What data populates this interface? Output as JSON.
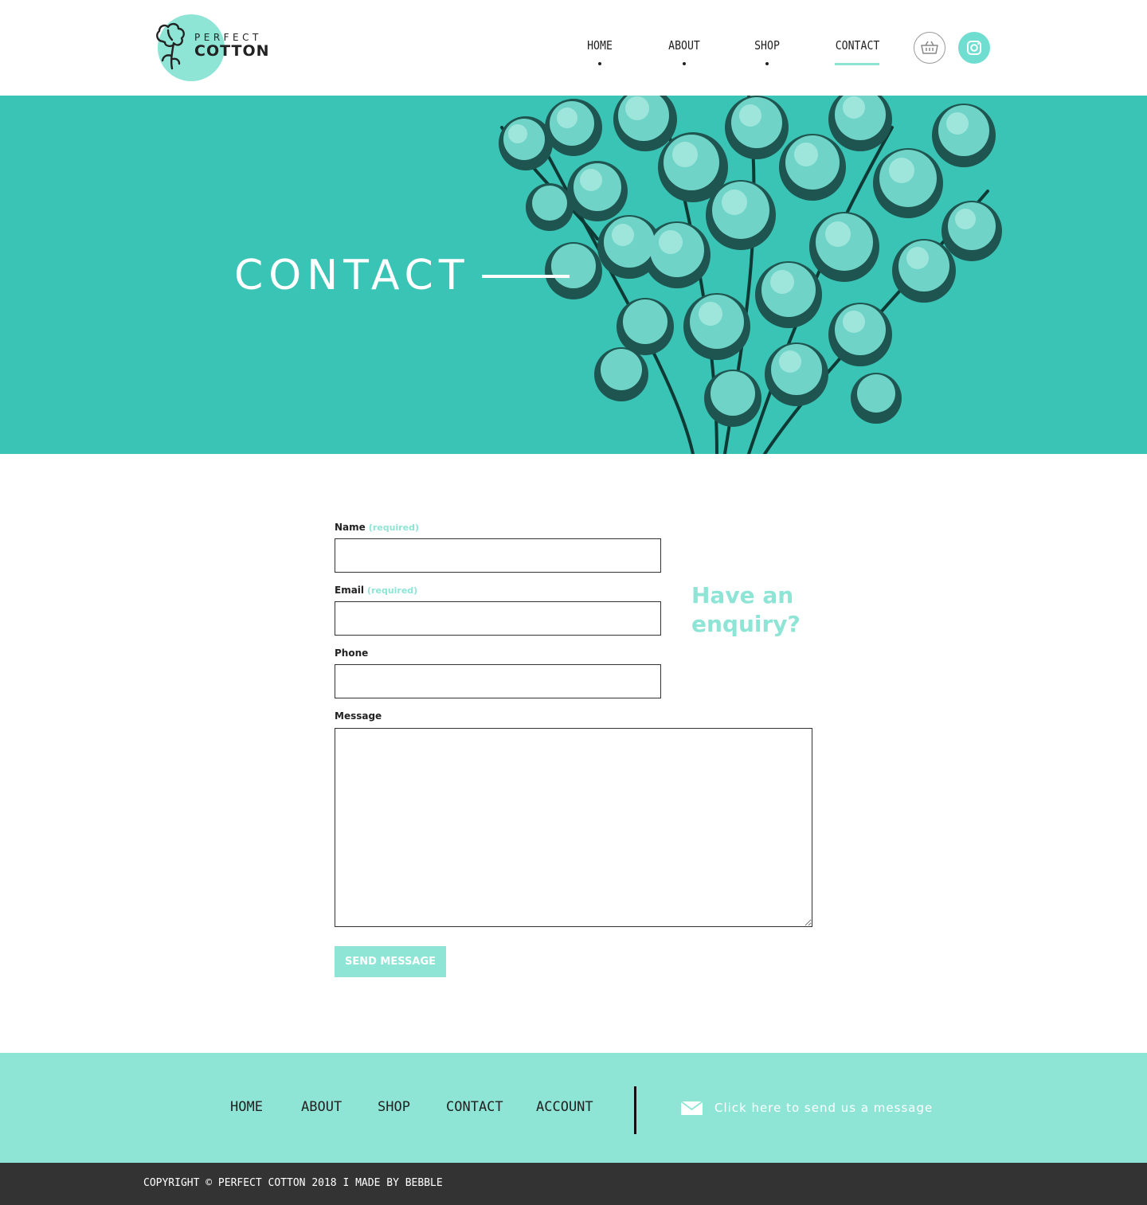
{
  "brand": {
    "name_top": "PERFECT",
    "name_bottom": "COTTON",
    "accent_color": "#8ee5d6",
    "hero_color": "#3ac4b5"
  },
  "nav": {
    "items": [
      {
        "label": "HOME",
        "active": false
      },
      {
        "label": "ABOUT",
        "active": false
      },
      {
        "label": "SHOP",
        "active": false
      },
      {
        "label": "CONTACT",
        "active": true
      }
    ],
    "cart_icon": "basket-icon",
    "social_icon": "instagram-icon"
  },
  "hero": {
    "title": "CONTACT"
  },
  "form": {
    "fields": [
      {
        "label": "Name",
        "required_note": "(required)",
        "value": ""
      },
      {
        "label": "Email",
        "required_note": "(required)",
        "value": ""
      },
      {
        "label": "Phone",
        "required_note": "",
        "value": ""
      }
    ],
    "message_label": "Message",
    "message_value": "",
    "submit_label": "SEND MESSAGE",
    "enquiry_text": "Have an enquiry?"
  },
  "footer": {
    "links": [
      "HOME",
      "ABOUT",
      "SHOP",
      "CONTACT",
      "ACCOUNT"
    ],
    "message_cta": "Click here to send us a message",
    "message_icon": "envelope-icon",
    "copyright": "COPYRIGHT © PERFECT COTTON 2018 I MADE BY BEBBLE"
  }
}
